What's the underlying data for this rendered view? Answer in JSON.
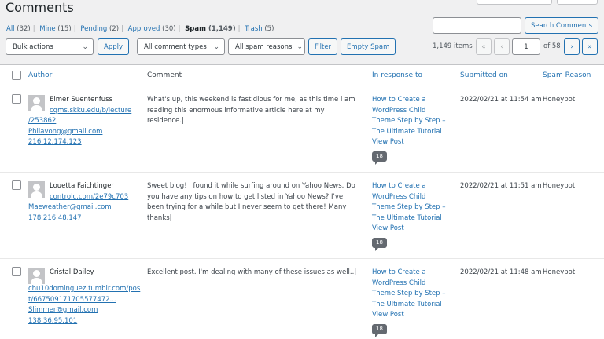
{
  "page": {
    "title": "Comments"
  },
  "filters": [
    {
      "label": "All",
      "count": "(32)",
      "current": false
    },
    {
      "label": "Mine",
      "count": "(15)",
      "current": false
    },
    {
      "label": "Pending",
      "count": "(2)",
      "current": false
    },
    {
      "label": "Approved",
      "count": "(30)",
      "current": false
    },
    {
      "label": "Spam",
      "count": "(1,149)",
      "current": true
    },
    {
      "label": "Trash",
      "count": "(5)",
      "current": false
    }
  ],
  "search": {
    "value": "",
    "button_label": "Search Comments"
  },
  "toolbar": {
    "bulk_actions": "Bulk actions",
    "apply_label": "Apply",
    "comment_types": "All comment types",
    "spam_reasons": "All spam reasons",
    "filter_label": "Filter",
    "empty_spam_label": "Empty Spam"
  },
  "pagination": {
    "items": "1,149 items",
    "first": "«",
    "prev": "‹",
    "current_page": "1",
    "of_pages": "of 58",
    "next": "›",
    "last": "»"
  },
  "columns": {
    "author": "Author",
    "comment": "Comment",
    "in_response_to": "In response to",
    "submitted_on": "Submitted on",
    "spam_reason": "Spam Reason"
  },
  "rows": [
    {
      "name": "Elmer Suentenfuss",
      "url": "cqms.skku.edu/b/lecture/253862",
      "url_line1": "cqms.skku.edu/b/lecture",
      "url_line2": "/253862",
      "email": "Philavong@gmail.com",
      "ip": "216.12.174.123",
      "comment": "What's up, this weekend is fastidious for me, as this time i am reading this enormous informative article here at my residence.|",
      "post_title": "How to Create a WordPress Child Theme Step by Step – The Ultimate Tutorial",
      "view_post": "View Post",
      "comment_count": "18",
      "date": "2022/02/21 at 11:54 am",
      "reason": "Honeypot"
    },
    {
      "name": "Louetta Faichtinger",
      "url": "controlc.com/2e79c703",
      "url_line1": "controlc.com/2e79c703",
      "url_line2": "",
      "email": "Maeweather@gmail.com",
      "ip": "178.216.48.147",
      "comment": "Sweet blog! I found it while surfing around on Yahoo News. Do you have any tips on how to get listed in Yahoo News? I've been trying for a while but I never seem to get there! Many thanks|",
      "post_title": "How to Create a WordPress Child Theme Step by Step – The Ultimate Tutorial",
      "view_post": "View Post",
      "comment_count": "18",
      "date": "2022/02/21 at 11:51 am",
      "reason": "Honeypot"
    },
    {
      "name": "Cristal Dailey",
      "url": "chu10dominguez.tumblr.com/post/667509171705577472...",
      "url_line1": "chu10dominguez.tumblr.com/pos",
      "url_line2": "t/667509171705577472...",
      "email": "Slimmer@gmail.com",
      "ip": "138.36.95.101",
      "comment": "Excellent post. I'm dealing with many of these issues as well..|",
      "post_title": "How to Create a WordPress Child Theme Step by Step – The Ultimate Tutorial",
      "view_post": "View Post",
      "comment_count": "18",
      "date": "2022/02/21 at 11:48 am",
      "reason": "Honeypot"
    }
  ]
}
